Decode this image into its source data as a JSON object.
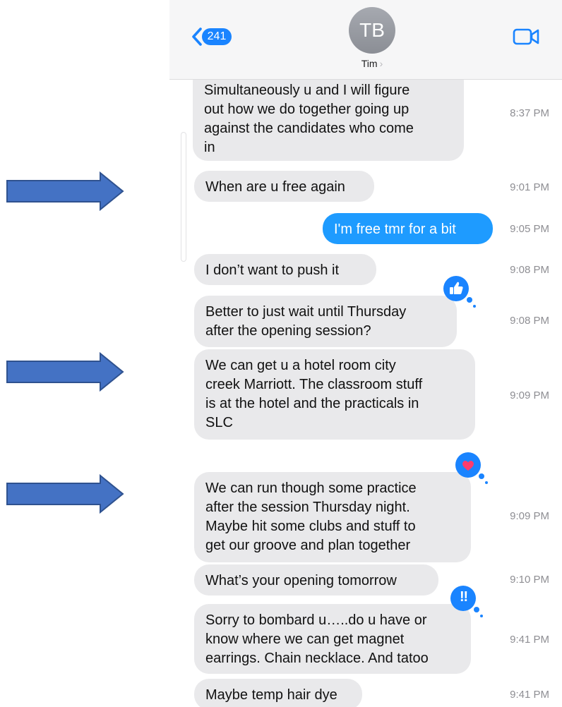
{
  "header": {
    "back_badge": "241",
    "avatar_initials": "TB",
    "contact_name": "Tim",
    "chevron": "›"
  },
  "icons": {
    "back": "chevron-left-icon",
    "video": "video-camera-icon",
    "thumbs_up": "thumbs-up-icon",
    "heart": "heart-icon",
    "exclamation": "double-exclamation-icon",
    "arrow": "right-arrow-icon"
  },
  "colors": {
    "accent": "#1a84ff",
    "sent_bubble": "#1e9bff",
    "received_bubble": "#e9e9eb",
    "heart": "#ff3b6e",
    "arrow_fill": "#4472c4",
    "arrow_stroke": "#2f528f"
  },
  "messages": [
    {
      "sender": "Tim",
      "lines": [
        "Simultaneously u and I will figure",
        "out how we do together going up",
        "against the candidates who come",
        "in"
      ],
      "time": "8:37 PM"
    },
    {
      "sender": "Tim",
      "lines": [
        "When are u free again"
      ],
      "time": "9:01 PM"
    },
    {
      "sender": "me",
      "lines": [
        "I'm free tmr for a bit"
      ],
      "time": "9:05 PM"
    },
    {
      "sender": "Tim",
      "lines": [
        "I don’t want to push it"
      ],
      "time": "9:08 PM"
    },
    {
      "sender": "Tim",
      "lines": [
        "Better to just wait until Thursday",
        "after the opening session?"
      ],
      "time": "9:08 PM",
      "tapback": "thumbs-up"
    },
    {
      "sender": "Tim",
      "lines": [
        "We can get u a hotel room city",
        "creek Marriott. The classroom stuff",
        "is at the hotel and the practicals in",
        "SLC"
      ],
      "time": "9:09 PM"
    },
    {
      "sender": "Tim",
      "lines": [
        "We can run though some practice",
        "after the session Thursday night.",
        "Maybe hit some clubs and stuff to",
        "get our  groove and plan together"
      ],
      "time": "9:09 PM",
      "tapback": "heart"
    },
    {
      "sender": "Tim",
      "lines": [
        "What’s your opening tomorrow"
      ],
      "time": "9:10 PM"
    },
    {
      "sender": "Tim",
      "lines": [
        "Sorry to bombard u…..do u have or",
        "know where we can get magnet",
        "earrings. Chain necklace. And tatoo"
      ],
      "time": "9:41 PM",
      "tapback": "exclamation"
    },
    {
      "sender": "Tim",
      "lines": [
        "Maybe temp hair dye"
      ],
      "time": "9:41 PM"
    }
  ],
  "tapback_symbols": {
    "exclamation": "‼"
  }
}
